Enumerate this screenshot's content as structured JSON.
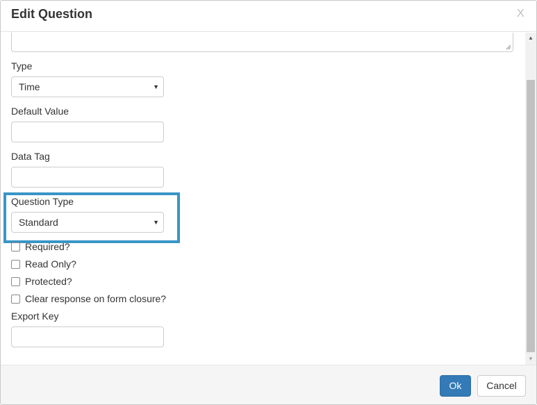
{
  "dialog": {
    "title": "Edit Question",
    "close_label": "X"
  },
  "form": {
    "type": {
      "label": "Type",
      "value": "Time"
    },
    "default_value": {
      "label": "Default Value",
      "value": ""
    },
    "data_tag": {
      "label": "Data Tag",
      "value": ""
    },
    "question_type": {
      "label": "Question Type",
      "value": "Standard"
    },
    "checkboxes": [
      {
        "label": "Required?",
        "checked": false
      },
      {
        "label": "Read Only?",
        "checked": false
      },
      {
        "label": "Protected?",
        "checked": false
      },
      {
        "label": "Clear response on form closure?",
        "checked": false
      }
    ],
    "export_key": {
      "label": "Export Key",
      "value": ""
    }
  },
  "footer": {
    "ok_label": "Ok",
    "cancel_label": "Cancel"
  },
  "colors": {
    "highlight": "#3a95c6",
    "primary_button": "#337ab7"
  },
  "icons": {
    "select_arrow": "caret-down-icon",
    "scroll_up": "scroll-up-icon",
    "scroll_down": "scroll-down-icon",
    "resize": "resize-grip-icon"
  }
}
